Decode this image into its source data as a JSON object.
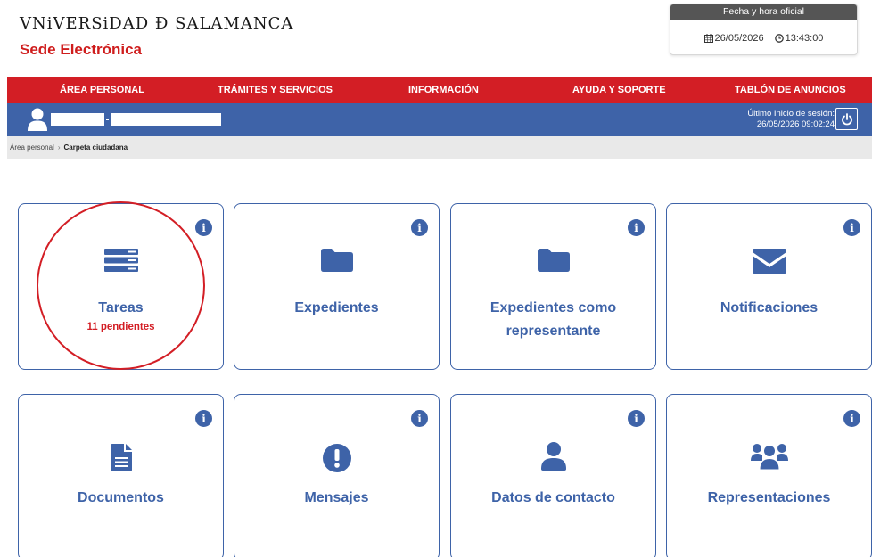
{
  "header": {
    "university": "VNiVERSiDAD Ð SALAMANCA",
    "sede": "Sede Electrónica"
  },
  "datetime": {
    "title": "Fecha y hora oficial",
    "date": "26/05/2026",
    "time": "13:43:00"
  },
  "nav": {
    "items": [
      "ÁREA PERSONAL",
      "TRÁMITES Y SERVICIOS",
      "INFORMACIÓN",
      "AYUDA Y SOPORTE",
      "TABLÓN DE ANUNCIOS"
    ]
  },
  "userbar": {
    "last_login_label": "Último Inicio de sesión:",
    "last_login_value": "26/05/2026 09:02:24"
  },
  "breadcrumb": {
    "parent": "Área personal",
    "current": "Carpeta ciudadana"
  },
  "cards": [
    {
      "title": "Tareas",
      "sub": "11 pendientes",
      "icon": "tasks-icon"
    },
    {
      "title": "Expedientes",
      "icon": "folder-icon"
    },
    {
      "title": "Expedientes como representante",
      "icon": "folder-icon"
    },
    {
      "title": "Notificaciones",
      "icon": "envelope-icon"
    },
    {
      "title": "Documentos",
      "icon": "document-icon"
    },
    {
      "title": "Mensajes",
      "icon": "exclamation-icon"
    },
    {
      "title": "Datos de contacto",
      "icon": "user-icon"
    },
    {
      "title": "Representaciones",
      "icon": "users-icon"
    }
  ],
  "colors": {
    "brand_red": "#d31e25",
    "brand_blue": "#3e63a8"
  }
}
